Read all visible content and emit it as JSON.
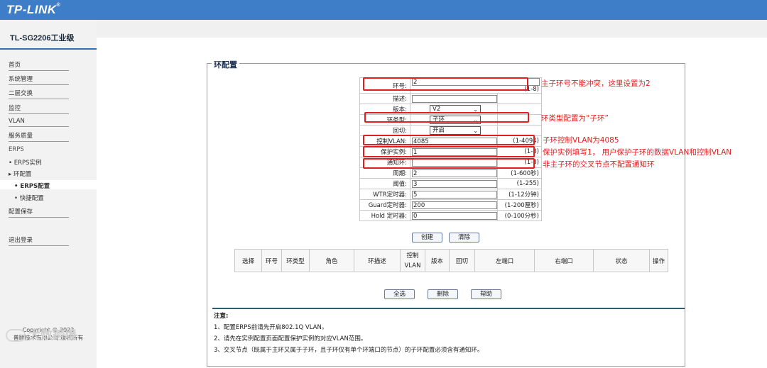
{
  "header": {
    "brand": "TP-LINK",
    "reg_mark": "®"
  },
  "sidebar": {
    "model": "TL-SG2206工业级",
    "items": [
      "首页",
      "系统管理",
      "二层交换",
      "监控",
      "VLAN",
      "服务质量"
    ],
    "erps": "ERPS",
    "erps_instance": "• ERPS实例",
    "ring_config": "▸ 环配置",
    "erps_config": "• ERPS配置",
    "quick_config": "• 快捷配置",
    "save_config": "配置保存",
    "logout": "退出登录",
    "copyright_1": "Copyright © 2023",
    "copyright_2": "普联技术有限公司 版权所有"
  },
  "watermark": "大数跨境",
  "panel": {
    "title": "环配置"
  },
  "form": {
    "ring_id": {
      "label": "环号:",
      "value": "2",
      "range": "(1-8)"
    },
    "desc": {
      "label": "描述:",
      "value": ""
    },
    "version": {
      "label": "版本:",
      "value": "V2"
    },
    "ring_type": {
      "label": "环类型:",
      "value": "子环"
    },
    "revert": {
      "label": "回切:",
      "value": "开启"
    },
    "ctrl_vlan": {
      "label": "控制VLAN:",
      "value": "4085",
      "range": "(1-4094)"
    },
    "instance": {
      "label": "保护实例:",
      "value": "1",
      "range": "(1-8)"
    },
    "notify": {
      "label": "通知环:",
      "value": "",
      "range": "(1-8)"
    },
    "period": {
      "label": "周期:",
      "value": "2",
      "range": "(1-600秒)"
    },
    "threshold": {
      "label": "阈值:",
      "value": "3",
      "range": "(1-255)"
    },
    "wtr": {
      "label": "WTR定时器:",
      "value": "5",
      "range": "(1-12分钟)"
    },
    "guard": {
      "label": "Guard定时器:",
      "value": "200",
      "range": "(1-200厘秒)"
    },
    "hold": {
      "label": "Hold 定时器:",
      "value": "0",
      "range": "(0-100分秒)"
    }
  },
  "buttons": {
    "create": "创建",
    "clear": "清除",
    "select_all": "全选",
    "delete": "删除",
    "help": "帮助"
  },
  "table": {
    "columns": [
      "选择",
      "环号",
      "环类型",
      "角色",
      "环描述",
      "控制\nVLAN",
      "版本",
      "回切",
      "左端口",
      "右端口",
      "状态",
      "操作"
    ]
  },
  "notes": {
    "title": "注意:",
    "lines": [
      "1、配置ERPS前请先开启802.1Q VLAN。",
      "2、请先在实例配置页面配置保护实例的对应VLAN范围。",
      "3、交叉节点（既属于主环又属于子环，且子环仅有单个环端口的节点）的子环配置必须含有通知环。"
    ]
  },
  "annotations": {
    "ring_id": "主子环号不能冲突，这里设置为2",
    "ring_type": "环类型配置为“子环”",
    "ctrl_vlan": "子环控制VLAN为4085",
    "instance": "保护实例填写1，  用户保护子环的数据VLAN和控制VLAN",
    "notify": "非主子环的交叉节点不配置通知环"
  },
  "colors": {
    "header_bg": "#3e7ec8",
    "annotation": "#e02020",
    "accent_line": "#2f6fb5"
  }
}
